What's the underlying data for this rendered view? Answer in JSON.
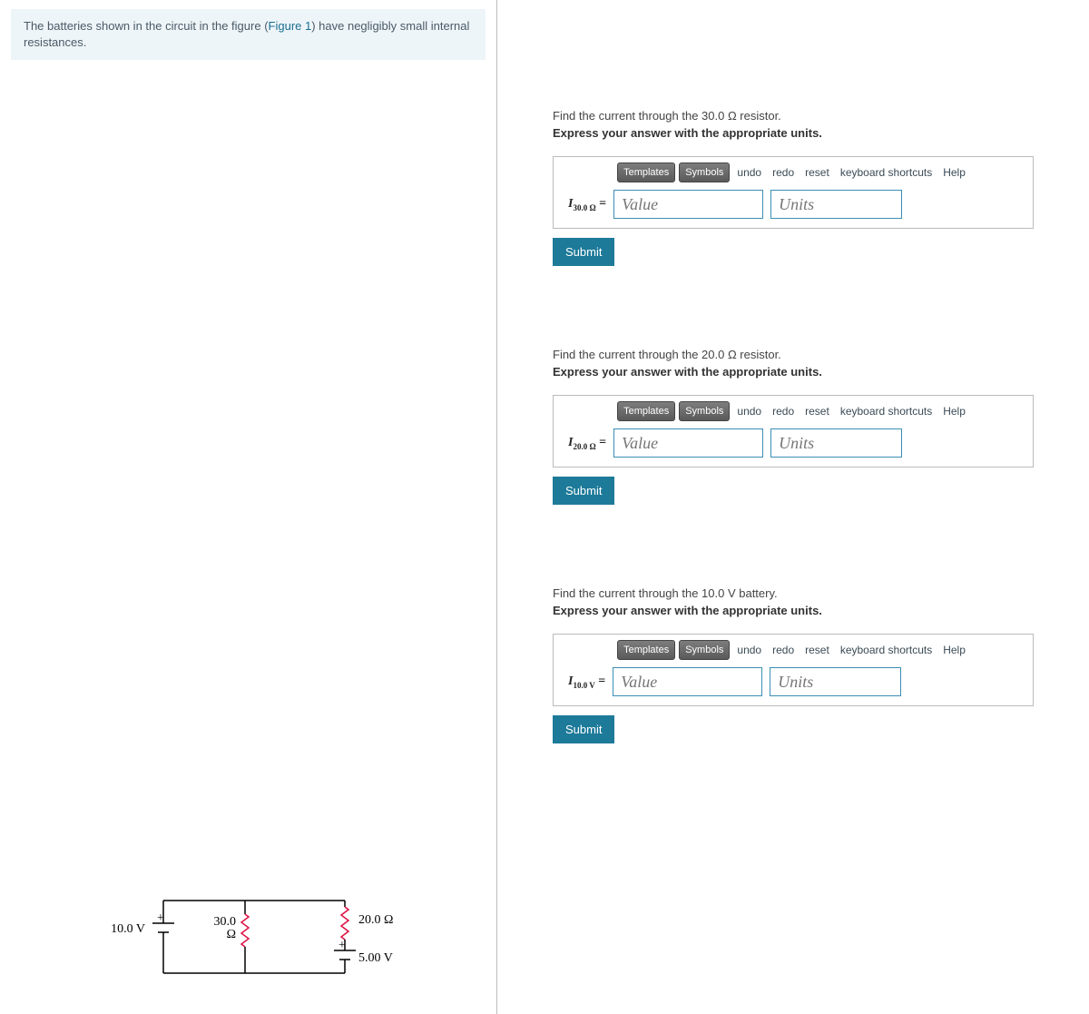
{
  "problem": {
    "text_before": "The batteries shown in the circuit in the figure (",
    "figure_link": "Figure 1",
    "text_after": ") have negligibly small internal resistances."
  },
  "circuit": {
    "battery1": "10.0 V",
    "resistor1_top": "30.0",
    "resistor1_bot": "Ω",
    "resistor2": "20.0 Ω",
    "battery2": "5.00 V"
  },
  "parts": [
    {
      "prompt": "Find the current through the 30.0 Ω resistor.",
      "instruction": "Express your answer with the appropriate units.",
      "var_main": "I",
      "var_sub": "30.0 Ω",
      "value_placeholder": "Value",
      "units_placeholder": "Units",
      "submit": "Submit",
      "toolbar": {
        "templates": "Templates",
        "symbols": "Symbols",
        "undo": "undo",
        "redo": "redo",
        "reset": "reset",
        "keyboard": "keyboard shortcuts",
        "help": "Help"
      }
    },
    {
      "prompt": "Find the current through the 20.0 Ω resistor.",
      "instruction": "Express your answer with the appropriate units.",
      "var_main": "I",
      "var_sub": "20.0 Ω",
      "value_placeholder": "Value",
      "units_placeholder": "Units",
      "submit": "Submit",
      "toolbar": {
        "templates": "Templates",
        "symbols": "Symbols",
        "undo": "undo",
        "redo": "redo",
        "reset": "reset",
        "keyboard": "keyboard shortcuts",
        "help": "Help"
      }
    },
    {
      "prompt": "Find the current through the 10.0 V battery.",
      "instruction": "Express your answer with the appropriate units.",
      "var_main": "I",
      "var_sub": "10.0 V",
      "value_placeholder": "Value",
      "units_placeholder": "Units",
      "submit": "Submit",
      "toolbar": {
        "templates": "Templates",
        "symbols": "Symbols",
        "undo": "undo",
        "redo": "redo",
        "reset": "reset",
        "keyboard": "keyboard shortcuts",
        "help": "Help"
      }
    }
  ]
}
